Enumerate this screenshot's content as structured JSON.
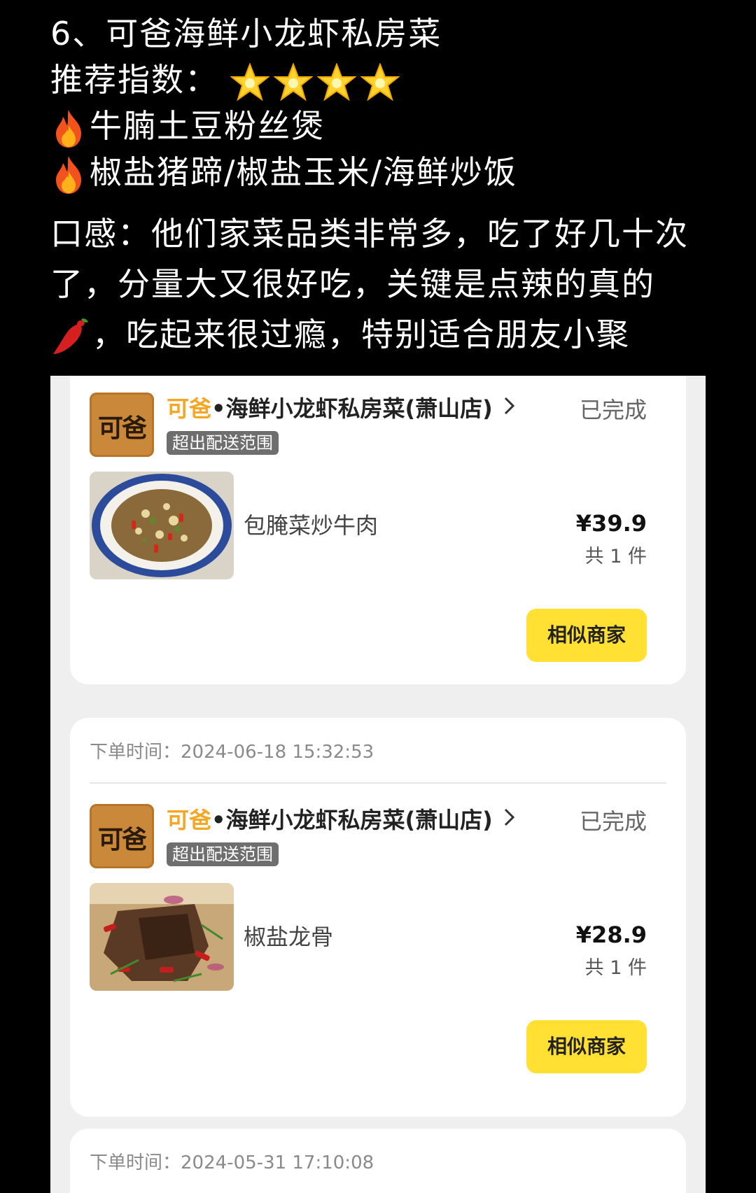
{
  "post": {
    "line1": "6、可爸海鲜小龙虾私房菜",
    "rating_label": "推荐指数：",
    "rating_stars": 4,
    "dish1": "牛腩土豆粉丝煲",
    "dish2": "椒盐猪蹄/椒盐玉米/海鲜炒饭",
    "taste_line1": "口感：他们家菜品类非常多，吃了好几十次",
    "taste_line2": "了，分量大又很好吃，关键是点辣的真的",
    "taste_line3": "，吃起来很过瘾，特别适合朋友小聚",
    "icons": [
      "star-icon",
      "fire-icon",
      "chili-icon"
    ]
  },
  "orders": [
    {
      "shop_prefix": "可爸",
      "shop_suffix": "•海鲜小龙虾私房菜(萧山店)",
      "logo_text": "可爸",
      "status": "已完成",
      "badge": "超出配送范围",
      "dish": "包腌菜炒牛肉",
      "price": "¥39.9",
      "count": "共 1 件",
      "button": "相似商家"
    },
    {
      "order_time_label": "下单时间：",
      "order_time": "2024-06-18 15:32:53",
      "shop_prefix": "可爸",
      "shop_suffix": "•海鲜小龙虾私房菜(萧山店)",
      "logo_text": "可爸",
      "status": "已完成",
      "badge": "超出配送范围",
      "dish": "椒盐龙骨",
      "price": "¥28.9",
      "count": "共 1 件",
      "button": "相似商家"
    },
    {
      "order_time_label": "下单时间：",
      "order_time": "2024-05-31 17:10:08"
    }
  ],
  "colors": {
    "accent_yellow": "#ffe033",
    "shop_highlight": "#f5a623",
    "badge_gray": "#6e6e6e"
  }
}
